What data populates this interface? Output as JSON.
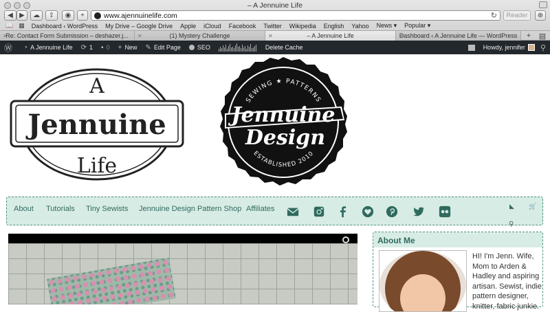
{
  "window": {
    "title": "– A Jennuine Life"
  },
  "toolbar": {
    "url": "www.ajennuinelife.com",
    "reader": "Reader"
  },
  "bookmarks": [
    "Dashboard ‹ WordPress",
    "My Drive – Google Drive",
    "Apple",
    "iCloud",
    "Facebook",
    "Twitter",
    "Wikipedia",
    "English",
    "Yahoo",
    "News ▾",
    "Popular ▾"
  ],
  "tabs": [
    {
      "label": "Re: Contact Form Submission – deshazer.j..."
    },
    {
      "label": "(1) Mystery Challenge"
    },
    {
      "label": "– A Jennuine Life"
    },
    {
      "label": "Dashboard ‹ A Jennuine Life — WordPress"
    }
  ],
  "wpbar": {
    "site": "A Jennuine Life",
    "updates": "1",
    "comments": "0",
    "new": "New",
    "edit": "Edit Page",
    "seo": "SEO",
    "cache": "Delete Cache",
    "howdy": "Howdy, jennifer"
  },
  "logo1": {
    "top": "A",
    "main": "Jennuine",
    "bottom": "Life"
  },
  "logo2": {
    "arc_top": "SEWING ★ PATTERNS",
    "line1": "Jennuine",
    "line2": "Design",
    "arc_bottom": "ESTABLISHED 2010"
  },
  "nav": [
    "About",
    "Tutorials",
    "Tiny Sewists",
    "Jennuine Design Pattern Shop",
    "Affiliates"
  ],
  "sidebar": {
    "title": "About Me",
    "bio": "HI! I'm Jenn. Wife, Mom to Arden & Hadley and aspiring artisan. Sewist, indie pattern designer, knitter, fabric junkie."
  },
  "colors": {
    "accent": "#2f6b5e",
    "nav_bg": "#d7ece5",
    "wpbar": "#23282d"
  }
}
